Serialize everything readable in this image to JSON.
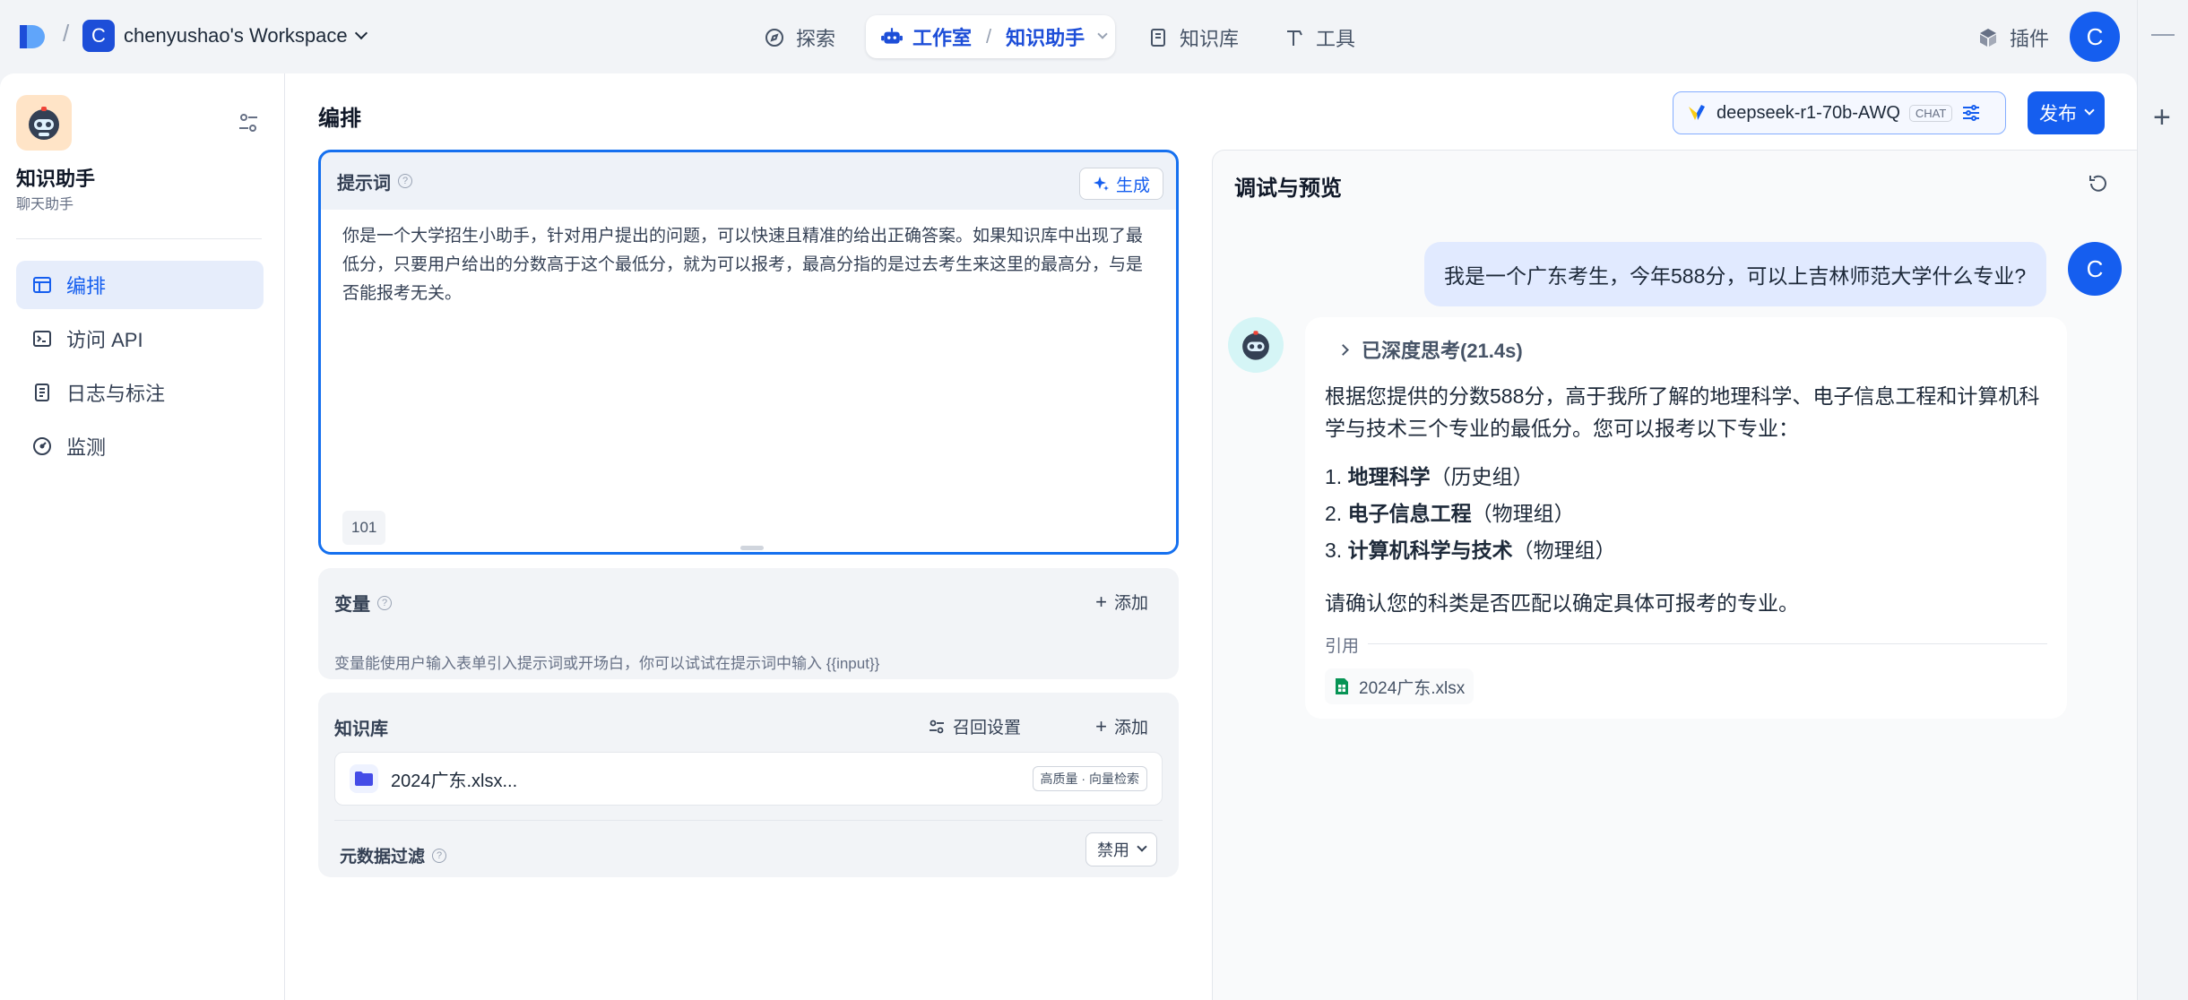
{
  "workspace": {
    "initial": "C",
    "name": "chenyushao's Workspace"
  },
  "nav": {
    "explore": "探索",
    "studio": "工作室",
    "current_app": "知识助手",
    "knowledge": "知识库",
    "tools": "工具",
    "plugins": "插件",
    "user_initial": "C"
  },
  "app": {
    "name": "知识助手",
    "type": "聊天助手"
  },
  "sidebar": {
    "items": [
      {
        "label": "编排",
        "active": true
      },
      {
        "label": "访问 API"
      },
      {
        "label": "日志与标注"
      },
      {
        "label": "监测"
      }
    ]
  },
  "editor": {
    "title": "编排",
    "prompt": {
      "label": "提示词",
      "generate": "生成",
      "text": "你是一个大学招生小助手，针对用户提出的问题，可以快速且精准的给出正确答案。如果知识库中出现了最低分，只要用户给出的分数高于这个最低分，就为可以报考，最高分指的是过去考生来这里的最高分，与是否能报考无关。",
      "count": "101"
    },
    "variables": {
      "label": "变量",
      "add": "添加",
      "desc": "变量能使用户输入表单引入提示词或开场白，你可以试试在提示词中输入 {{input}}"
    },
    "knowledge": {
      "label": "知识库",
      "recall": "召回设置",
      "add": "添加",
      "file": "2024广东.xlsx...",
      "tag": "高质量 · 向量检索",
      "meta_filter": "元数据过滤",
      "meta_value": "禁用"
    }
  },
  "model": {
    "name": "deepseek-r1-70b-AWQ",
    "tag": "CHAT"
  },
  "publish": "发布",
  "preview": {
    "title": "调试与预览",
    "user_message": "我是一个广东考生，今年588分，可以上吉林师范大学什么专业?",
    "user_initial": "C",
    "think": "已深度思考(21.4s)",
    "answer_intro": "根据您提供的分数588分，高于我所了解的地理科学、电子信息工程和计算机科学与技术三个专业的最低分。您可以报考以下专业：",
    "majors": [
      {
        "num": "1.",
        "name": "地理科学",
        "group": "（历史组）"
      },
      {
        "num": "2.",
        "name": "电子信息工程",
        "group": "（物理组）"
      },
      {
        "num": "3.",
        "name": "计算机科学与技术",
        "group": "（物理组）"
      }
    ],
    "answer_end": "请确认您的科类是否匹配以确定具体可报考的专业。",
    "cite_label": "引用",
    "cite_file": "2024广东.xlsx"
  },
  "colors": {
    "accent": "#155eef",
    "active_bg": "#e6edfb",
    "user_bubble": "#e1eaff"
  }
}
